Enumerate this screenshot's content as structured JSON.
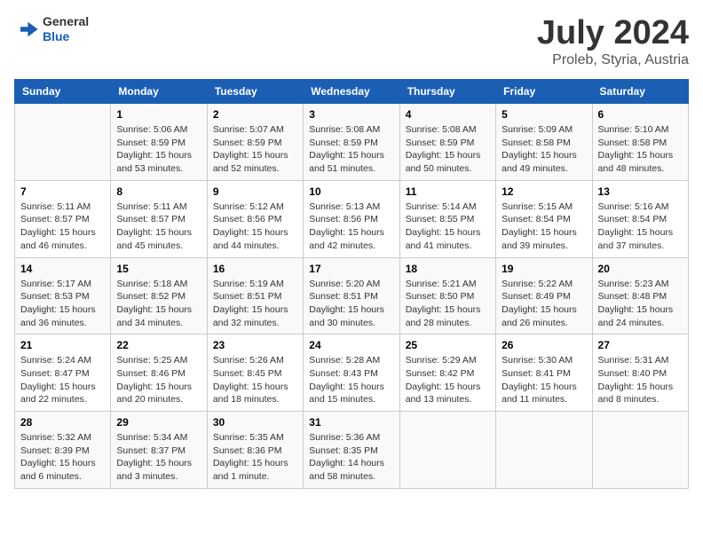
{
  "header": {
    "logo_line1": "General",
    "logo_line2": "Blue",
    "title": "July 2024",
    "subtitle": "Proleb, Styria, Austria"
  },
  "calendar": {
    "days_of_week": [
      "Sunday",
      "Monday",
      "Tuesday",
      "Wednesday",
      "Thursday",
      "Friday",
      "Saturday"
    ],
    "weeks": [
      [
        {
          "day": "",
          "info": ""
        },
        {
          "day": "1",
          "info": "Sunrise: 5:06 AM\nSunset: 8:59 PM\nDaylight: 15 hours\nand 53 minutes."
        },
        {
          "day": "2",
          "info": "Sunrise: 5:07 AM\nSunset: 8:59 PM\nDaylight: 15 hours\nand 52 minutes."
        },
        {
          "day": "3",
          "info": "Sunrise: 5:08 AM\nSunset: 8:59 PM\nDaylight: 15 hours\nand 51 minutes."
        },
        {
          "day": "4",
          "info": "Sunrise: 5:08 AM\nSunset: 8:59 PM\nDaylight: 15 hours\nand 50 minutes."
        },
        {
          "day": "5",
          "info": "Sunrise: 5:09 AM\nSunset: 8:58 PM\nDaylight: 15 hours\nand 49 minutes."
        },
        {
          "day": "6",
          "info": "Sunrise: 5:10 AM\nSunset: 8:58 PM\nDaylight: 15 hours\nand 48 minutes."
        }
      ],
      [
        {
          "day": "7",
          "info": "Sunrise: 5:11 AM\nSunset: 8:57 PM\nDaylight: 15 hours\nand 46 minutes."
        },
        {
          "day": "8",
          "info": "Sunrise: 5:11 AM\nSunset: 8:57 PM\nDaylight: 15 hours\nand 45 minutes."
        },
        {
          "day": "9",
          "info": "Sunrise: 5:12 AM\nSunset: 8:56 PM\nDaylight: 15 hours\nand 44 minutes."
        },
        {
          "day": "10",
          "info": "Sunrise: 5:13 AM\nSunset: 8:56 PM\nDaylight: 15 hours\nand 42 minutes."
        },
        {
          "day": "11",
          "info": "Sunrise: 5:14 AM\nSunset: 8:55 PM\nDaylight: 15 hours\nand 41 minutes."
        },
        {
          "day": "12",
          "info": "Sunrise: 5:15 AM\nSunset: 8:54 PM\nDaylight: 15 hours\nand 39 minutes."
        },
        {
          "day": "13",
          "info": "Sunrise: 5:16 AM\nSunset: 8:54 PM\nDaylight: 15 hours\nand 37 minutes."
        }
      ],
      [
        {
          "day": "14",
          "info": "Sunrise: 5:17 AM\nSunset: 8:53 PM\nDaylight: 15 hours\nand 36 minutes."
        },
        {
          "day": "15",
          "info": "Sunrise: 5:18 AM\nSunset: 8:52 PM\nDaylight: 15 hours\nand 34 minutes."
        },
        {
          "day": "16",
          "info": "Sunrise: 5:19 AM\nSunset: 8:51 PM\nDaylight: 15 hours\nand 32 minutes."
        },
        {
          "day": "17",
          "info": "Sunrise: 5:20 AM\nSunset: 8:51 PM\nDaylight: 15 hours\nand 30 minutes."
        },
        {
          "day": "18",
          "info": "Sunrise: 5:21 AM\nSunset: 8:50 PM\nDaylight: 15 hours\nand 28 minutes."
        },
        {
          "day": "19",
          "info": "Sunrise: 5:22 AM\nSunset: 8:49 PM\nDaylight: 15 hours\nand 26 minutes."
        },
        {
          "day": "20",
          "info": "Sunrise: 5:23 AM\nSunset: 8:48 PM\nDaylight: 15 hours\nand 24 minutes."
        }
      ],
      [
        {
          "day": "21",
          "info": "Sunrise: 5:24 AM\nSunset: 8:47 PM\nDaylight: 15 hours\nand 22 minutes."
        },
        {
          "day": "22",
          "info": "Sunrise: 5:25 AM\nSunset: 8:46 PM\nDaylight: 15 hours\nand 20 minutes."
        },
        {
          "day": "23",
          "info": "Sunrise: 5:26 AM\nSunset: 8:45 PM\nDaylight: 15 hours\nand 18 minutes."
        },
        {
          "day": "24",
          "info": "Sunrise: 5:28 AM\nSunset: 8:43 PM\nDaylight: 15 hours\nand 15 minutes."
        },
        {
          "day": "25",
          "info": "Sunrise: 5:29 AM\nSunset: 8:42 PM\nDaylight: 15 hours\nand 13 minutes."
        },
        {
          "day": "26",
          "info": "Sunrise: 5:30 AM\nSunset: 8:41 PM\nDaylight: 15 hours\nand 11 minutes."
        },
        {
          "day": "27",
          "info": "Sunrise: 5:31 AM\nSunset: 8:40 PM\nDaylight: 15 hours\nand 8 minutes."
        }
      ],
      [
        {
          "day": "28",
          "info": "Sunrise: 5:32 AM\nSunset: 8:39 PM\nDaylight: 15 hours\nand 6 minutes."
        },
        {
          "day": "29",
          "info": "Sunrise: 5:34 AM\nSunset: 8:37 PM\nDaylight: 15 hours\nand 3 minutes."
        },
        {
          "day": "30",
          "info": "Sunrise: 5:35 AM\nSunset: 8:36 PM\nDaylight: 15 hours\nand 1 minute."
        },
        {
          "day": "31",
          "info": "Sunrise: 5:36 AM\nSunset: 8:35 PM\nDaylight: 14 hours\nand 58 minutes."
        },
        {
          "day": "",
          "info": ""
        },
        {
          "day": "",
          "info": ""
        },
        {
          "day": "",
          "info": ""
        }
      ]
    ]
  }
}
